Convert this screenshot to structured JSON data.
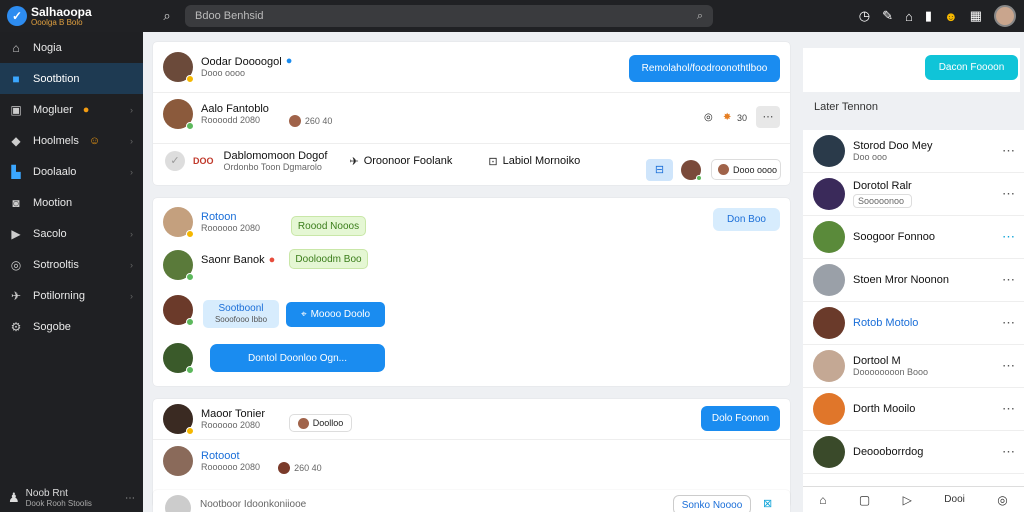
{
  "brand": {
    "title": "Salhaoopa",
    "subtitle": "Ooolga B Bolo"
  },
  "search": {
    "placeholder": "Bdoo Benhsid"
  },
  "sidebar": {
    "items": [
      {
        "label": "Nogia",
        "icon": "home-icon"
      },
      {
        "label": "Sootbtion",
        "icon": "chat-icon",
        "active": true
      },
      {
        "label": "Mogluer",
        "icon": "inbox-icon"
      },
      {
        "label": "Hoolmels",
        "icon": "tag-icon"
      },
      {
        "label": "Doolaalo",
        "icon": "bookmark-icon"
      },
      {
        "label": "Mootion",
        "icon": "camera-icon"
      },
      {
        "label": "Sacolo",
        "icon": "play-icon"
      },
      {
        "label": "Sotrooltis",
        "icon": "globe-icon"
      },
      {
        "label": "Potilorning",
        "icon": "pin-icon"
      },
      {
        "label": "Sogobe",
        "icon": "settings-icon"
      }
    ],
    "footer": {
      "name": "Noob Rnt",
      "sub": "Dook Rooh Stoolis"
    }
  },
  "card1": {
    "header_name": "Oodar Doooogol",
    "header_sub": "Dooo oooo",
    "header_button": "Remolahol/foodroonothtlboo",
    "post_name": "Aalo Fantoblo",
    "post_sub": "Roooodd 2080",
    "post_meta": "260 40",
    "post_count": "30",
    "action_title": "Dablomomoon Dogof",
    "action_sub": "Ordonbo Toon Dgmarolo",
    "action_mid": "Oroonoor Foolank",
    "action_right": "Labiol Mornoiko",
    "action_pill": "Dooo oooo",
    "action_red": "DOO"
  },
  "card2": {
    "name1": "Rotoon",
    "sub1": "Roooooo 2080",
    "pill1": "Roood Nooos",
    "button": "Don Boo",
    "name2": "Saonr Banok",
    "pill2": "Dooloodm Boo",
    "pill3a": "Sootboonl",
    "pill3a_sub": "Sooofooo Ibbo",
    "pill3b": "Moooo Doolo",
    "input_value": "Dontol Doonloo Ogn..."
  },
  "card3": {
    "name1": "Maoor Tonier",
    "sub1": "Roooooo 2080",
    "pill1": "Doolloo",
    "button": "Dolo Foonon",
    "name2": "Rotooot",
    "sub2": "Roooooo 2080",
    "meta2": "260 40"
  },
  "card4": {
    "title": "Nootboor Idoonkoniiooe",
    "button": "Sonko Noooo"
  },
  "right": {
    "header_button": "Dacon Foooon",
    "section_title": "Later Tennon",
    "items": [
      {
        "name": "Storod Doo Mey",
        "sub": "Doo ooo"
      },
      {
        "name": "Dorotol Ralr",
        "sub": "Sooooonoo"
      },
      {
        "name": "Soogoor Fonnoo",
        "sub": ""
      },
      {
        "name": "Stoen Mror Noonon",
        "sub": ""
      },
      {
        "name": "Rotob Motolo",
        "sub": ""
      },
      {
        "name": "Dortool M",
        "sub": "Doooooooon Booo"
      },
      {
        "name": "Dorth Mooilo",
        "sub": ""
      },
      {
        "name": "Deoooborrdog",
        "sub": ""
      }
    ],
    "bottom_label": "Dooi"
  },
  "colors": {
    "accent": "#1a8cf0",
    "sidebar": "#1f2023",
    "cyan": "#10c4d8"
  }
}
